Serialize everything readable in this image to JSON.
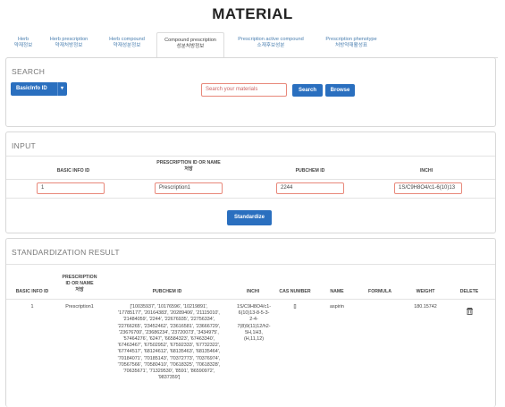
{
  "page": {
    "title": "MATERIAL"
  },
  "tabs": [
    {
      "en": "Herb",
      "ko": "약재정보"
    },
    {
      "en": "Herb prescription",
      "ko": "약재처방정보"
    },
    {
      "en": "Herb compound",
      "ko": "약재성분정보"
    },
    {
      "en": "Compound prescription",
      "ko": "성분처방정보"
    },
    {
      "en": "Prescription active compound",
      "ko": "소재후보성분"
    },
    {
      "en": "Prescription phenotype",
      "ko": "처방약재활성표"
    }
  ],
  "search": {
    "title": "SEARCH",
    "dropdown_label": "BasicInfo ID",
    "input_placeholder": "Search your materials",
    "search_button": "Search",
    "browse_button": "Browse"
  },
  "input": {
    "title": "INPUT",
    "headers": {
      "basic_info_id": "BASIC INFO ID",
      "prescription_line1": "PRESCRIPTION ID OR NAME",
      "prescription_line2": "처방",
      "pubchem_id": "PUBCHEM ID",
      "inchi": "INCHI"
    },
    "values": {
      "basic_info_id": "1",
      "prescription": "Prescription1",
      "pubchem_id": "2244",
      "inchi": "1S/C9H8O4/c1-6(10)13"
    },
    "standardize_button": "Standardize"
  },
  "result": {
    "title": "STANDARDIZATION RESULT",
    "headers": {
      "basic_info_id": "BASIC INFO ID",
      "prescription_l1": "PRESCRIPTION",
      "prescription_l2": "ID OR NAME",
      "prescription_l3": "처방",
      "pubchem_id": "PUBCHEM ID",
      "inchi": "INCHI",
      "cas_number": "CAS NUMBER",
      "name": "NAME",
      "formula": "FORMULA",
      "weight": "WEIGHT",
      "delete": "DELETE"
    },
    "row": {
      "basic_info_id": "1",
      "prescription": "Prescription1",
      "pubchem_lines": [
        "['10035937', '10176596', '10219891',",
        "'17785177', '20164383', '20289406', '21115010',",
        "'21484059', '2244', '22676935', '22756334',",
        "'22766265', '23452462', '23616581', '23666729',",
        "'23676700', '23686234', '23720073', '3434975',",
        "'57464276', '6247', '66584323', '67463340',",
        "'67463467', '67502952', '67592333', '67732322',",
        "'67744517', '68124612', '68135463', '68135464',",
        "'70184071', '70185143', '70372773', '70376974',",
        "'70567566', '70580410', '70618325', '70618328',",
        "'70635671', '71329530', '8591', '86590972',",
        "'9837359']"
      ],
      "inchi_lines": [
        "1S/C9H8O4/c1-",
        "6(10)13-8-5-3-",
        "2-4-",
        "7(8)9(11)12/h2-",
        "5H,1H3,",
        "(H,11,12)"
      ],
      "cas_number": "[]",
      "name": "aspirin",
      "formula": "",
      "weight": "180.15742"
    }
  },
  "colors": {
    "primary": "#2a6fbf",
    "tab_link": "#4a7fb0",
    "input_border": "#e8887a"
  }
}
